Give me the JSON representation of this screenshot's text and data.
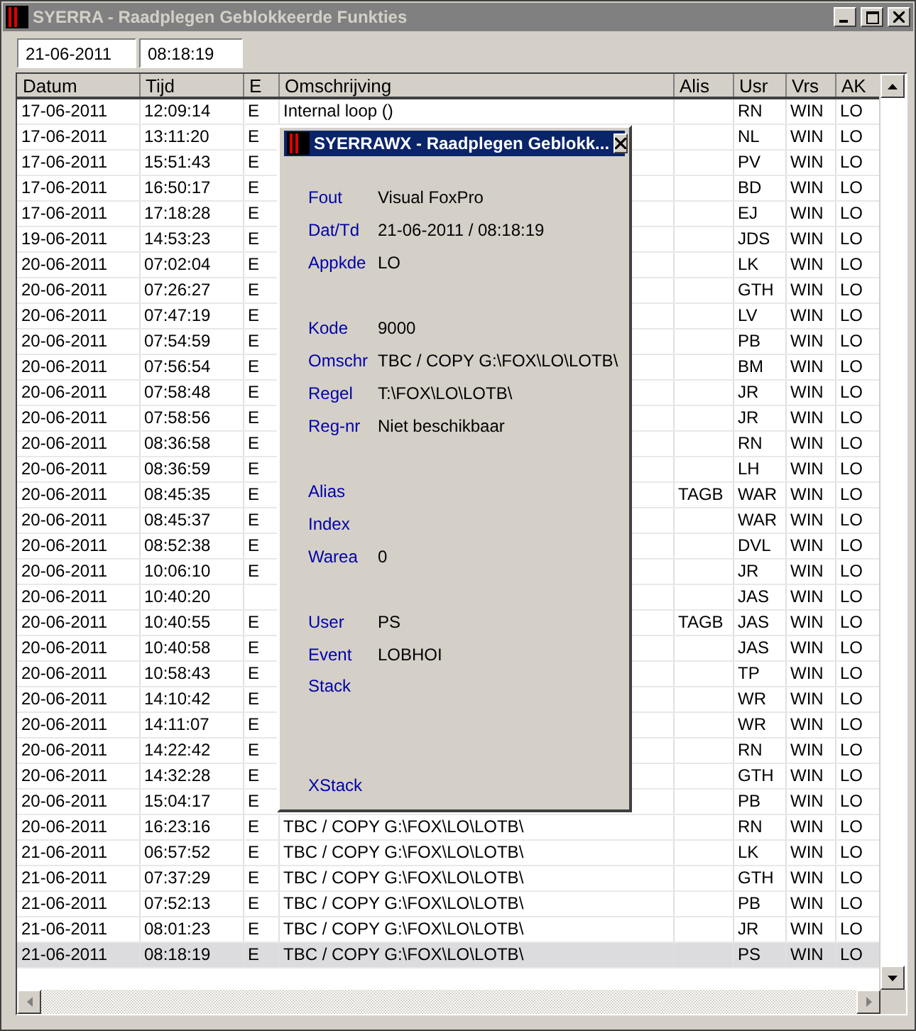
{
  "window": {
    "title": "SYERRA - Raadplegen Geblokkeerde Funkties"
  },
  "filters": {
    "date": "21-06-2011",
    "time": "08:18:19"
  },
  "table": {
    "columns": [
      "Datum",
      "Tijd",
      "E",
      "Omschrijving",
      "Alis",
      "Usr",
      "Vrs",
      "AK"
    ],
    "rows": [
      {
        "datum": "17-06-2011",
        "tijd": "12:09:14",
        "e": "E",
        "omschrijving": "Internal loop ()",
        "usr": "RN",
        "vrs": "WIN",
        "ak": "LO",
        "selected": false
      },
      {
        "datum": "17-06-2011",
        "tijd": "13:11:20",
        "e": "E",
        "usr": "NL",
        "vrs": "WIN",
        "ak": "LO",
        "selected": false
      },
      {
        "datum": "17-06-2011",
        "tijd": "15:51:43",
        "e": "E",
        "usr": "PV",
        "vrs": "WIN",
        "ak": "LO",
        "selected": false
      },
      {
        "datum": "17-06-2011",
        "tijd": "16:50:17",
        "e": "E",
        "usr": "BD",
        "vrs": "WIN",
        "ak": "LO",
        "selected": false
      },
      {
        "datum": "17-06-2011",
        "tijd": "17:18:28",
        "e": "E",
        "usr": "EJ",
        "vrs": "WIN",
        "ak": "LO",
        "selected": false
      },
      {
        "datum": "19-06-2011",
        "tijd": "14:53:23",
        "e": "E",
        "usr": "JDS",
        "vrs": "WIN",
        "ak": "LO",
        "selected": false
      },
      {
        "datum": "20-06-2011",
        "tijd": "07:02:04",
        "e": "E",
        "usr": "LK",
        "vrs": "WIN",
        "ak": "LO",
        "selected": false
      },
      {
        "datum": "20-06-2011",
        "tijd": "07:26:27",
        "e": "E",
        "usr": "GTH",
        "vrs": "WIN",
        "ak": "LO",
        "selected": false
      },
      {
        "datum": "20-06-2011",
        "tijd": "07:47:19",
        "e": "E",
        "usr": "LV",
        "vrs": "WIN",
        "ak": "LO",
        "selected": false
      },
      {
        "datum": "20-06-2011",
        "tijd": "07:54:59",
        "e": "E",
        "usr": "PB",
        "vrs": "WIN",
        "ak": "LO",
        "selected": false
      },
      {
        "datum": "20-06-2011",
        "tijd": "07:56:54",
        "e": "E",
        "usr": "BM",
        "vrs": "WIN",
        "ak": "LO",
        "selected": false
      },
      {
        "datum": "20-06-2011",
        "tijd": "07:58:48",
        "e": "E",
        "usr": "JR",
        "vrs": "WIN",
        "ak": "LO",
        "selected": false
      },
      {
        "datum": "20-06-2011",
        "tijd": "07:58:56",
        "e": "E",
        "usr": "JR",
        "vrs": "WIN",
        "ak": "LO",
        "selected": false
      },
      {
        "datum": "20-06-2011",
        "tijd": "08:36:58",
        "e": "E",
        "usr": "RN",
        "vrs": "WIN",
        "ak": "LO",
        "selected": false
      },
      {
        "datum": "20-06-2011",
        "tijd": "08:36:59",
        "e": "E",
        "usr": "LH",
        "vrs": "WIN",
        "ak": "LO",
        "selected": false
      },
      {
        "datum": "20-06-2011",
        "tijd": "08:45:35",
        "e": "E",
        "alis": "TAGB",
        "usr": "WAR",
        "vrs": "WIN",
        "ak": "LO",
        "selected": false
      },
      {
        "datum": "20-06-2011",
        "tijd": "08:45:37",
        "e": "E",
        "usr": "WAR",
        "vrs": "WIN",
        "ak": "LO",
        "selected": false
      },
      {
        "datum": "20-06-2011",
        "tijd": "08:52:38",
        "e": "E",
        "usr": "DVL",
        "vrs": "WIN",
        "ak": "LO",
        "selected": false
      },
      {
        "datum": "20-06-2011",
        "tijd": "10:06:10",
        "e": "E",
        "usr": "JR",
        "vrs": "WIN",
        "ak": "LO",
        "selected": false
      },
      {
        "datum": "20-06-2011",
        "tijd": "10:40:20",
        "usr": "JAS",
        "vrs": "WIN",
        "ak": "LO",
        "selected": false
      },
      {
        "datum": "20-06-2011",
        "tijd": "10:40:55",
        "e": "E",
        "alis": "TAGB",
        "usr": "JAS",
        "vrs": "WIN",
        "ak": "LO",
        "selected": false
      },
      {
        "datum": "20-06-2011",
        "tijd": "10:40:58",
        "e": "E",
        "usr": "JAS",
        "vrs": "WIN",
        "ak": "LO",
        "selected": false
      },
      {
        "datum": "20-06-2011",
        "tijd": "10:58:43",
        "e": "E",
        "usr": "TP",
        "vrs": "WIN",
        "ak": "LO",
        "selected": false
      },
      {
        "datum": "20-06-2011",
        "tijd": "14:10:42",
        "e": "E",
        "usr": "WR",
        "vrs": "WIN",
        "ak": "LO",
        "selected": false
      },
      {
        "datum": "20-06-2011",
        "tijd": "14:11:07",
        "e": "E",
        "usr": "WR",
        "vrs": "WIN",
        "ak": "LO",
        "selected": false
      },
      {
        "datum": "20-06-2011",
        "tijd": "14:22:42",
        "e": "E",
        "usr": "RN",
        "vrs": "WIN",
        "ak": "LO",
        "selected": false
      },
      {
        "datum": "20-06-2011",
        "tijd": "14:32:28",
        "e": "E",
        "usr": "GTH",
        "vrs": "WIN",
        "ak": "LO",
        "selected": false
      },
      {
        "datum": "20-06-2011",
        "tijd": "15:04:17",
        "e": "E",
        "usr": "PB",
        "vrs": "WIN",
        "ak": "LO",
        "selected": false
      },
      {
        "datum": "20-06-2011",
        "tijd": "16:23:16",
        "e": "E",
        "omschrijving": "TBC / COPY G:\\FOX\\LO\\LOTB\\",
        "usr": "RN",
        "vrs": "WIN",
        "ak": "LO",
        "selected": false
      },
      {
        "datum": "21-06-2011",
        "tijd": "06:57:52",
        "e": "E",
        "omschrijving": "TBC / COPY G:\\FOX\\LO\\LOTB\\",
        "usr": "LK",
        "vrs": "WIN",
        "ak": "LO",
        "selected": false
      },
      {
        "datum": "21-06-2011",
        "tijd": "07:37:29",
        "e": "E",
        "omschrijving": "TBC / COPY G:\\FOX\\LO\\LOTB\\",
        "usr": "GTH",
        "vrs": "WIN",
        "ak": "LO",
        "selected": false
      },
      {
        "datum": "21-06-2011",
        "tijd": "07:52:13",
        "e": "E",
        "omschrijving": "TBC / COPY G:\\FOX\\LO\\LOTB\\",
        "usr": "PB",
        "vrs": "WIN",
        "ak": "LO",
        "selected": false
      },
      {
        "datum": "21-06-2011",
        "tijd": "08:01:23",
        "e": "E",
        "omschrijving": "TBC / COPY G:\\FOX\\LO\\LOTB\\",
        "usr": "JR",
        "vrs": "WIN",
        "ak": "LO",
        "selected": false
      },
      {
        "datum": "21-06-2011",
        "tijd": "08:18:19",
        "e": "E",
        "omschrijving": "TBC / COPY G:\\FOX\\LO\\LOTB\\",
        "usr": "PS",
        "vrs": "WIN",
        "ak": "LO",
        "selected": true
      }
    ]
  },
  "dialog": {
    "title": "SYERRAWX - Raadplegen Geblokk...",
    "groups": [
      [
        {
          "label": "Fout",
          "value": "Visual FoxPro"
        },
        {
          "label": "Dat/Td",
          "value": "21-06-2011 / 08:18:19"
        },
        {
          "label": "Appkde",
          "value": "LO"
        }
      ],
      [
        {
          "label": "Kode",
          "value": "9000"
        },
        {
          "label": "Omschr",
          "value": "TBC / COPY G:\\FOX\\LO\\LOTB\\"
        },
        {
          "label": "Regel",
          "value": "T:\\FOX\\LO\\LOTB\\"
        },
        {
          "label": "Reg-nr",
          "value": "Niet beschikbaar"
        }
      ],
      [
        {
          "label": "Alias"
        },
        {
          "label": "Index"
        },
        {
          "label": "Warea",
          "value": "0"
        }
      ],
      [
        {
          "label": "User",
          "value": "PS"
        },
        {
          "label": "Event",
          "value": "LOBHOI"
        },
        {
          "label": "Stack",
          "kind": "memo"
        },
        {
          "label": "XStack",
          "kind": "line"
        }
      ]
    ]
  }
}
